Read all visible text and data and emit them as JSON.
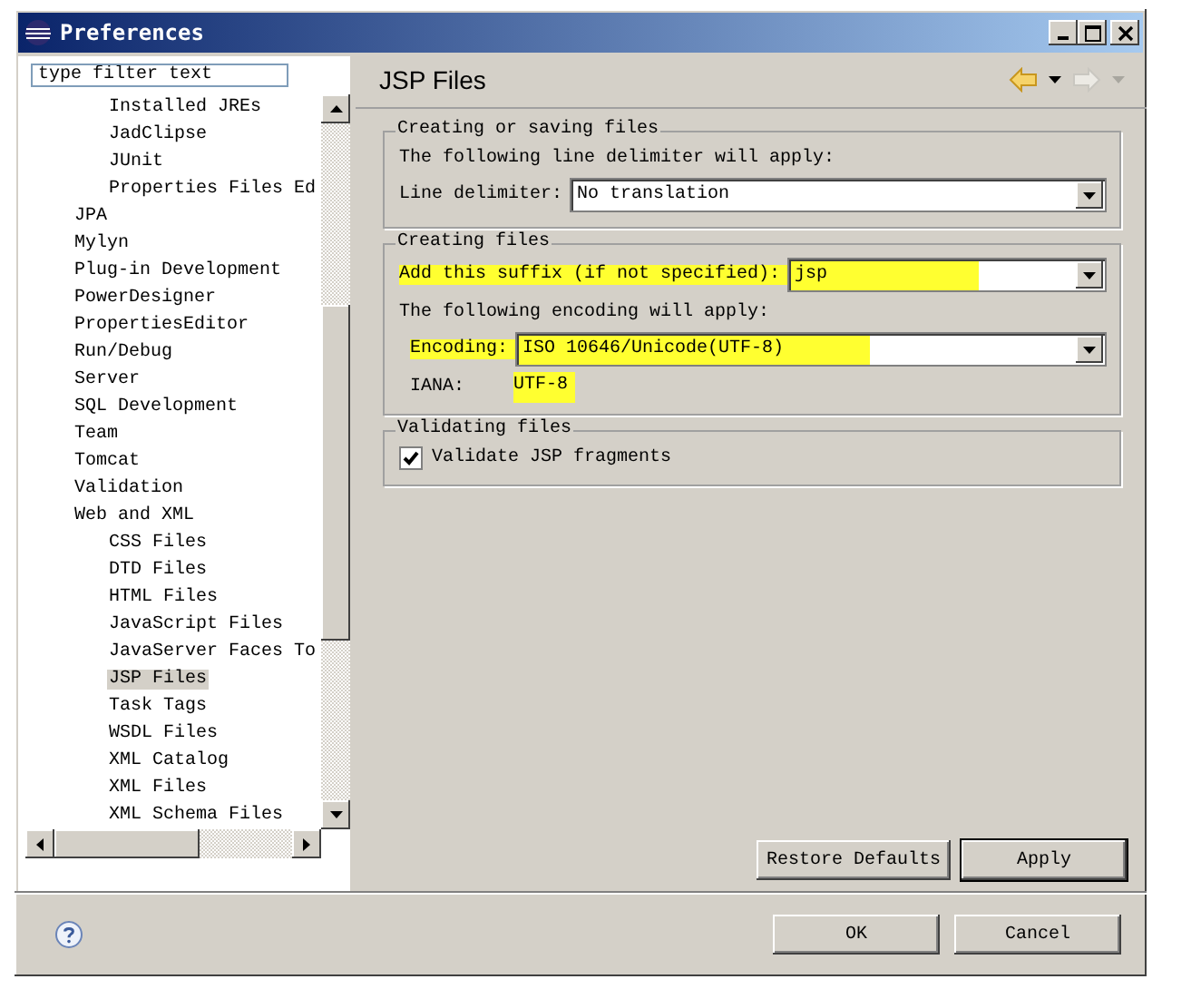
{
  "window": {
    "title": "Preferences"
  },
  "filter": {
    "placeholder": "type filter text"
  },
  "tree": {
    "continued_children": [
      {
        "label": "Installed JREs",
        "selected": false
      },
      {
        "label": "JadClipse",
        "selected": false
      },
      {
        "label": "JUnit",
        "selected": false
      },
      {
        "label": "Properties Files Ed",
        "selected": false
      }
    ],
    "items": [
      {
        "label": "JPA",
        "selected": false
      },
      {
        "label": "Mylyn",
        "selected": false
      },
      {
        "label": "Plug-in Development",
        "selected": false
      },
      {
        "label": "PowerDesigner",
        "selected": false
      },
      {
        "label": "PropertiesEditor",
        "selected": false
      },
      {
        "label": "Run/Debug",
        "selected": false
      },
      {
        "label": "Server",
        "selected": false
      },
      {
        "label": "SQL Development",
        "selected": false
      },
      {
        "label": "Team",
        "selected": false
      },
      {
        "label": "Tomcat",
        "selected": false
      },
      {
        "label": "Validation",
        "selected": false
      },
      {
        "label": "Web and XML",
        "selected": false,
        "children": [
          {
            "label": "CSS Files",
            "selected": false
          },
          {
            "label": "DTD Files",
            "selected": false
          },
          {
            "label": "HTML Files",
            "selected": false
          },
          {
            "label": "JavaScript Files",
            "selected": false
          },
          {
            "label": "JavaServer Faces To",
            "selected": false
          },
          {
            "label": "JSP Files",
            "selected": true
          },
          {
            "label": "Task Tags",
            "selected": false
          },
          {
            "label": "WSDL Files",
            "selected": false
          },
          {
            "label": "XML Catalog",
            "selected": false
          },
          {
            "label": "XML Files",
            "selected": false
          },
          {
            "label": "XML Schema Files",
            "selected": false
          }
        ]
      }
    ]
  },
  "page": {
    "title": "JSP Files",
    "groups": [
      {
        "title": "Creating or saving files",
        "rows": [
          {
            "kind": "text",
            "text": "The following line delimiter will apply:"
          },
          {
            "kind": "select",
            "label": "Line delimiter:",
            "value": "No translation",
            "highlighted": false
          }
        ]
      },
      {
        "title": "Creating files",
        "rows": [
          {
            "kind": "select",
            "label": "Add this suffix (if not specified):",
            "value": "jsp",
            "highlighted": true
          },
          {
            "kind": "text",
            "text": "The following encoding will apply:"
          },
          {
            "kind": "select",
            "label": "Encoding:",
            "value": "ISO 10646/Unicode(UTF-8)",
            "highlighted": true,
            "indent": true
          },
          {
            "kind": "info",
            "label": "IANA:",
            "value": "UTF-8",
            "highlighted": true
          }
        ]
      },
      {
        "title": "Validating files",
        "rows": [
          {
            "kind": "checkbox",
            "label": "Validate JSP fragments",
            "checked": true
          }
        ]
      }
    ],
    "buttons": [
      "Restore Defaults",
      "Apply"
    ]
  },
  "footer": {
    "buttons": [
      "OK",
      "Cancel"
    ]
  }
}
